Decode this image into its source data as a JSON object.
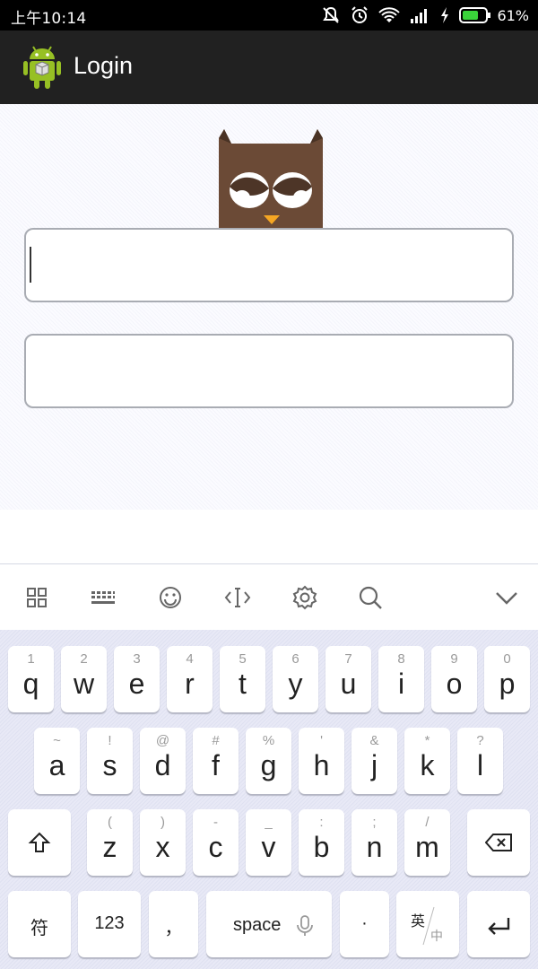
{
  "status_bar": {
    "time": "上午10:14",
    "battery_percent": "61%",
    "icons": [
      "mute-icon",
      "alarm-icon",
      "wifi-icon",
      "signal-icon",
      "charging-icon",
      "battery-icon"
    ]
  },
  "action_bar": {
    "title": "Login",
    "icon": "android-icon",
    "background": "#212121"
  },
  "form": {
    "username_value": "",
    "password_value": ""
  },
  "keyboard_toolbar": {
    "icons": [
      "grid-icon",
      "keyboard-icon",
      "emoji-icon",
      "cursor-icon",
      "settings-icon",
      "search-icon",
      "chevron-down-icon"
    ]
  },
  "keyboard": {
    "row1": [
      {
        "hint": "1",
        "key": "q"
      },
      {
        "hint": "2",
        "key": "w"
      },
      {
        "hint": "3",
        "key": "e"
      },
      {
        "hint": "4",
        "key": "r"
      },
      {
        "hint": "5",
        "key": "t"
      },
      {
        "hint": "6",
        "key": "y"
      },
      {
        "hint": "7",
        "key": "u"
      },
      {
        "hint": "8",
        "key": "i"
      },
      {
        "hint": "9",
        "key": "o"
      },
      {
        "hint": "0",
        "key": "p"
      }
    ],
    "row2": [
      {
        "hint": "~",
        "key": "a"
      },
      {
        "hint": "!",
        "key": "s"
      },
      {
        "hint": "@",
        "key": "d"
      },
      {
        "hint": "#",
        "key": "f"
      },
      {
        "hint": "%",
        "key": "g"
      },
      {
        "hint": "'",
        "key": "h"
      },
      {
        "hint": "&",
        "key": "j"
      },
      {
        "hint": "*",
        "key": "k"
      },
      {
        "hint": "?",
        "key": "l"
      }
    ],
    "row3": [
      {
        "hint": "(",
        "key": "z"
      },
      {
        "hint": ")",
        "key": "x"
      },
      {
        "hint": "-",
        "key": "c"
      },
      {
        "hint": "_",
        "key": "v"
      },
      {
        "hint": ":",
        "key": "b"
      },
      {
        "hint": ";",
        "key": "n"
      },
      {
        "hint": "/",
        "key": "m"
      }
    ],
    "row4": {
      "symbols": "符",
      "numbers": "123",
      "comma": "，",
      "space": "space",
      "period": "·",
      "lang_en": "英",
      "lang_zh": "中"
    }
  }
}
